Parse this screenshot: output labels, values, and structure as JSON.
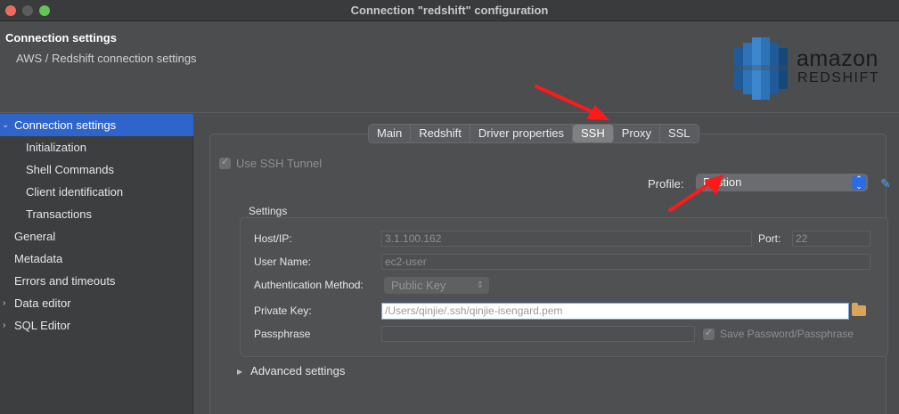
{
  "window": {
    "title": "Connection \"redshift\" configuration"
  },
  "header": {
    "title": "Connection settings",
    "subtitle": "AWS / Redshift connection settings",
    "logo_line1": "amazon",
    "logo_line2": "REDSHIFT"
  },
  "sidebar": {
    "items": [
      {
        "label": "Connection settings",
        "expanded": true,
        "selected": true
      },
      {
        "label": "Initialization"
      },
      {
        "label": "Shell Commands"
      },
      {
        "label": "Client identification"
      },
      {
        "label": "Transactions"
      },
      {
        "label": "General"
      },
      {
        "label": "Metadata"
      },
      {
        "label": "Errors and timeouts"
      },
      {
        "label": "Data editor",
        "expandable": true
      },
      {
        "label": "SQL Editor",
        "expandable": true
      }
    ]
  },
  "tabs": [
    {
      "label": "Main"
    },
    {
      "label": "Redshift"
    },
    {
      "label": "Driver properties"
    },
    {
      "label": "SSH",
      "active": true
    },
    {
      "label": "Proxy"
    },
    {
      "label": "SSL"
    }
  ],
  "ssh": {
    "use_tunnel_label": "Use SSH Tunnel",
    "use_tunnel_checked": true,
    "profile_label": "Profile:",
    "profile_value": "Bastion",
    "settings_title": "Settings",
    "host_label": "Host/IP:",
    "host_value": "3.1.100.162",
    "port_label": "Port:",
    "port_value": "22",
    "user_label": "User Name:",
    "user_value": "ec2-user",
    "auth_label": "Authentication Method:",
    "auth_value": "Public Key",
    "key_label": "Private Key:",
    "key_value": "/Users/qinjie/.ssh/qinjie-isengard.pem",
    "pass_label": "Passphrase",
    "pass_value": "",
    "save_label": "Save Password/Passphrase",
    "save_checked": true,
    "advanced_label": "Advanced settings"
  },
  "colors": {
    "selection": "#2f65ca",
    "annotation_arrow": "#ff1a1a",
    "accent": "#2d6ce0"
  }
}
